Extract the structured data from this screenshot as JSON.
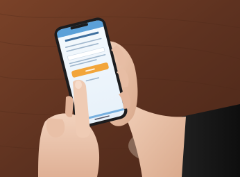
{
  "photo": {
    "subject": "hands-holding-smartphone",
    "screen": {
      "heading": "",
      "primary_button": {
        "color": "#f2a53a",
        "label": ""
      },
      "secondary_link": {
        "label": ""
      }
    }
  },
  "colors": {
    "table": "#6b3a24",
    "phone_body": "#1c1c1e",
    "screen_bg": "#eef5fb",
    "screen_header": "#5ba0d8",
    "accent_button": "#f2a53a",
    "sleeve": "#1a1a1a",
    "skin": "#e8c2aa"
  }
}
